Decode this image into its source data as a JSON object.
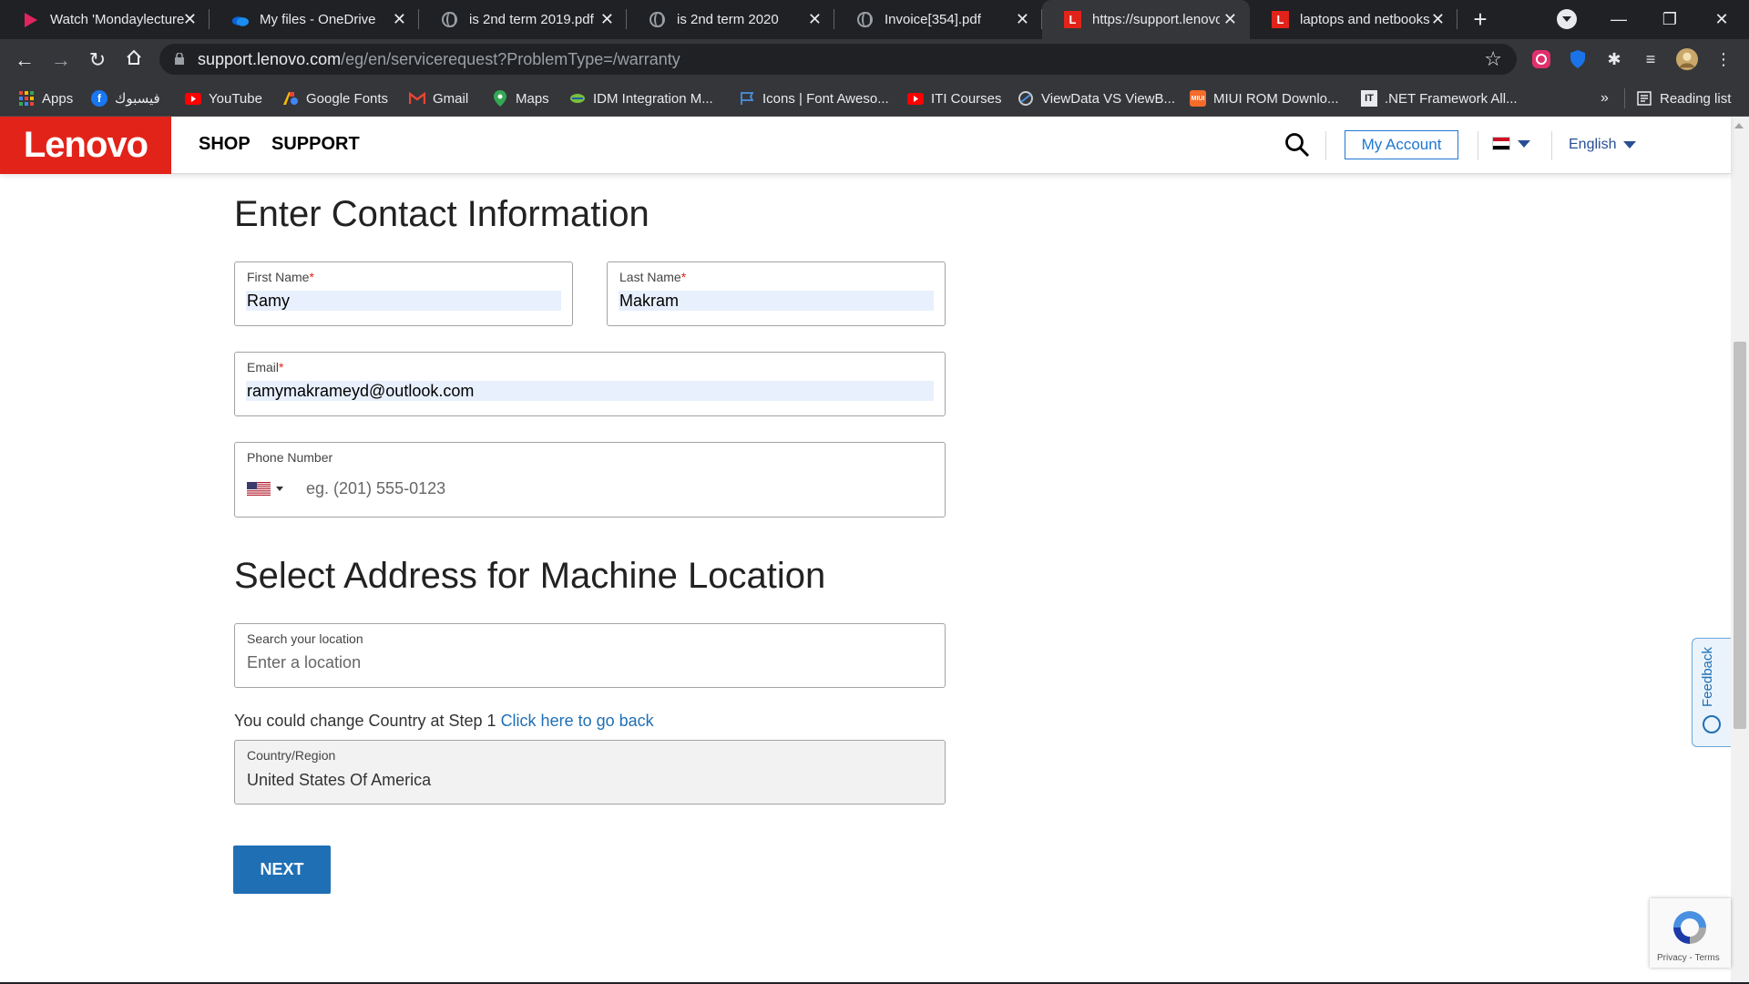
{
  "browser": {
    "tabs": [
      {
        "title": "Watch 'Mondaylecture",
        "icon": "play-icon",
        "active": false
      },
      {
        "title": "My files - OneDrive",
        "icon": "onedrive-icon",
        "active": false
      },
      {
        "title": "is 2nd term 2019.pdf",
        "icon": "globe-icon",
        "active": false
      },
      {
        "title": "is 2nd term 2020",
        "icon": "globe-icon",
        "active": false
      },
      {
        "title": "Invoice[354].pdf",
        "icon": "globe-icon",
        "active": false
      },
      {
        "title": "https://support.lenovo",
        "icon": "lenovo-icon",
        "active": true
      },
      {
        "title": "laptops and netbooks",
        "icon": "lenovo-icon",
        "active": false
      }
    ],
    "new_tab_symbol": "+",
    "address": {
      "host": "support.lenovo.com",
      "path": "/eg/en/servicerequest?ProblemType=/warranty"
    },
    "bookmarks": [
      {
        "label": "Apps",
        "icon": "apps-grid-icon"
      },
      {
        "label": "فيسبوك",
        "icon": "facebook-icon"
      },
      {
        "label": "YouTube",
        "icon": "youtube-icon"
      },
      {
        "label": "Google Fonts",
        "icon": "google-fonts-icon"
      },
      {
        "label": "Gmail",
        "icon": "gmail-icon"
      },
      {
        "label": "Maps",
        "icon": "maps-icon"
      },
      {
        "label": "IDM Integration M...",
        "icon": "idm-icon"
      },
      {
        "label": "Icons | Font Aweso...",
        "icon": "flag-icon"
      },
      {
        "label": "ITI Courses",
        "icon": "youtube-icon"
      },
      {
        "label": "ViewData VS ViewB...",
        "icon": "viewdata-icon"
      },
      {
        "label": "MIUI ROM Downlo...",
        "icon": "miui-icon"
      },
      {
        "label": ".NET Framework All...",
        "icon": "it-icon"
      }
    ],
    "more_bookmarks": "»",
    "reading_list": "Reading list",
    "miui_badge": "MIUI",
    "it_badge": "IT"
  },
  "site": {
    "logo": "Lenovo",
    "nav": [
      "SHOP",
      "SUPPORT"
    ],
    "my_account": "My Account",
    "language": "English",
    "colors": {
      "brand": "#e2231a",
      "link": "#1f6fb5",
      "account": "#1f78d1"
    }
  },
  "contact": {
    "heading": "Enter Contact Information",
    "first_name": {
      "label": "First Name",
      "required": "*",
      "value": "Ramy"
    },
    "last_name": {
      "label": "Last Name",
      "required": "*",
      "value": "Makram"
    },
    "email": {
      "label": "Email",
      "required": "*",
      "value": "ramymakrameyd@outlook.com"
    },
    "phone": {
      "label": "Phone Number",
      "placeholder": "eg. (201) 555-0123"
    }
  },
  "address": {
    "heading": "Select Address for Machine Location",
    "search": {
      "label": "Search your location",
      "placeholder": "Enter a location"
    },
    "note": "You could change Country at Step 1",
    "note_link": "Click here to go back",
    "country": {
      "label": "Country/Region",
      "value": "United States Of America"
    }
  },
  "next_button": "NEXT",
  "feedback": "Feedback",
  "recaptcha": {
    "text": "Privacy - Terms"
  }
}
